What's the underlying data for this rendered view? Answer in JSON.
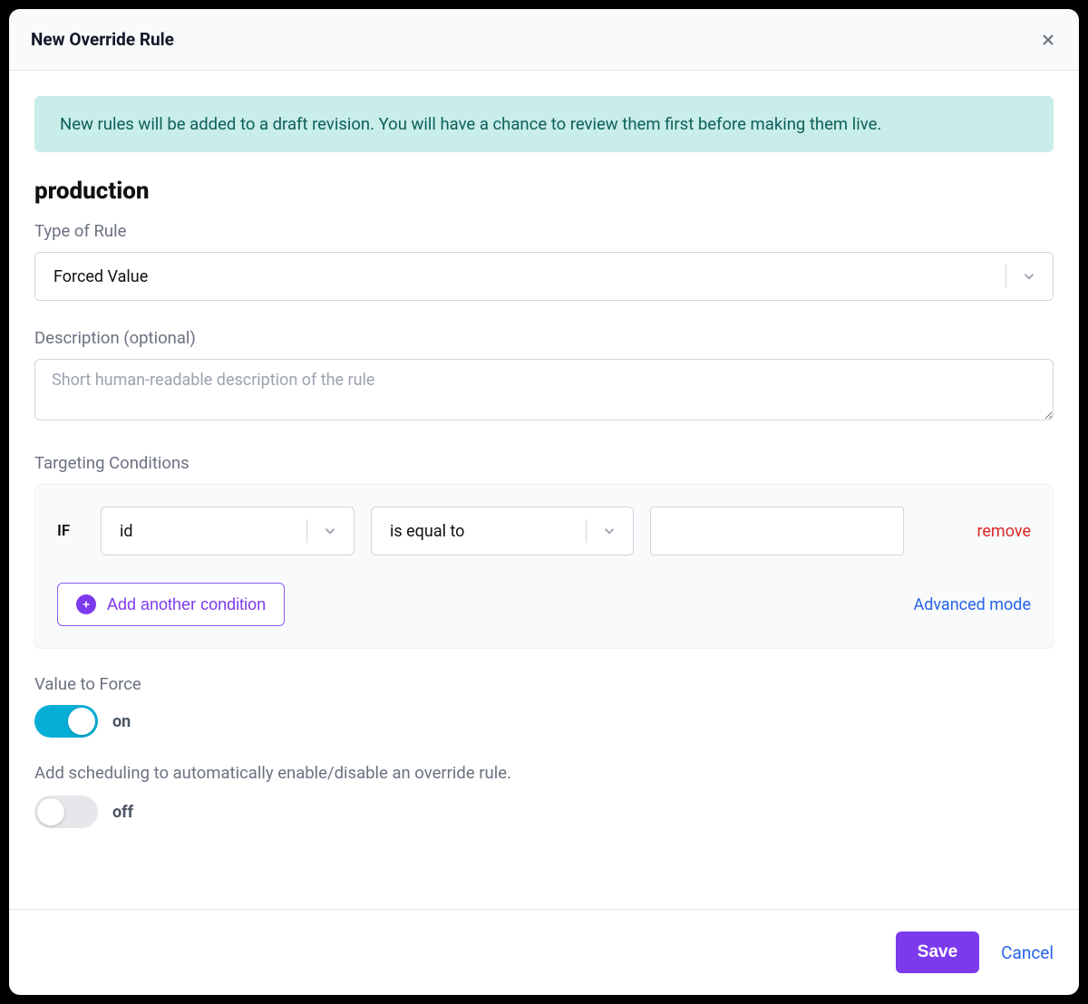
{
  "modal": {
    "title": "New Override Rule",
    "info_banner": "New rules will be added to a draft revision. You will have a chance to review them first before making them live."
  },
  "section": {
    "environment": "production"
  },
  "fields": {
    "type_label": "Type of Rule",
    "type_value": "Forced Value",
    "description_label": "Description (optional)",
    "description_placeholder": "Short human-readable description of the rule",
    "targeting_label": "Targeting Conditions",
    "value_force_label": "Value to Force",
    "scheduling_label": "Add scheduling to automatically enable/disable an override rule."
  },
  "condition": {
    "if_label": "IF",
    "attribute": "id",
    "operator": "is equal to",
    "value": "",
    "remove_label": "remove",
    "add_label": "Add another condition",
    "advanced_label": "Advanced mode"
  },
  "toggles": {
    "value_force_state": "on",
    "scheduling_state": "off"
  },
  "footer": {
    "save_label": "Save",
    "cancel_label": "Cancel"
  }
}
